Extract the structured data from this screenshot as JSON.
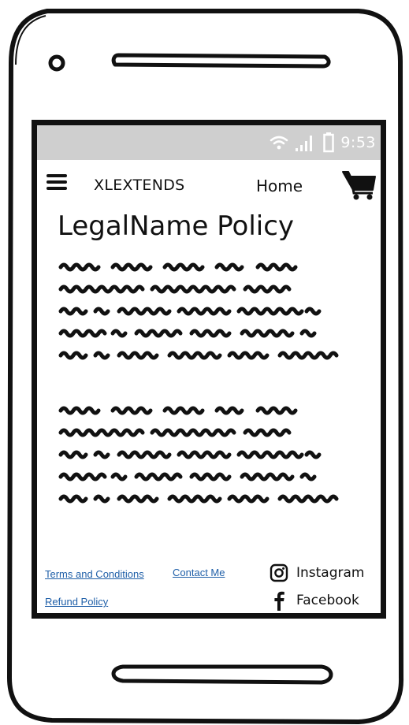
{
  "status_bar": {
    "time": "9:53"
  },
  "navbar": {
    "brand": "XLEXTENDS",
    "home_label": "Home"
  },
  "page": {
    "title": "LegalName Policy"
  },
  "footer": {
    "terms_label": "Terms and Conditions",
    "contact_label": "Contact Me",
    "refund_label": "Refund Policy",
    "instagram_label": "Instagram",
    "facebook_label": "Facebook"
  },
  "icons": {
    "menu": "hamburger-icon",
    "cart": "cart-icon",
    "wifi": "wifi-icon",
    "signal": "signal-icon",
    "battery": "battery-icon",
    "instagram": "instagram-icon",
    "facebook": "facebook-icon"
  },
  "colors": {
    "status_bar": "#cfcfcf",
    "link": "#1f5fa8",
    "ink": "#111111"
  }
}
